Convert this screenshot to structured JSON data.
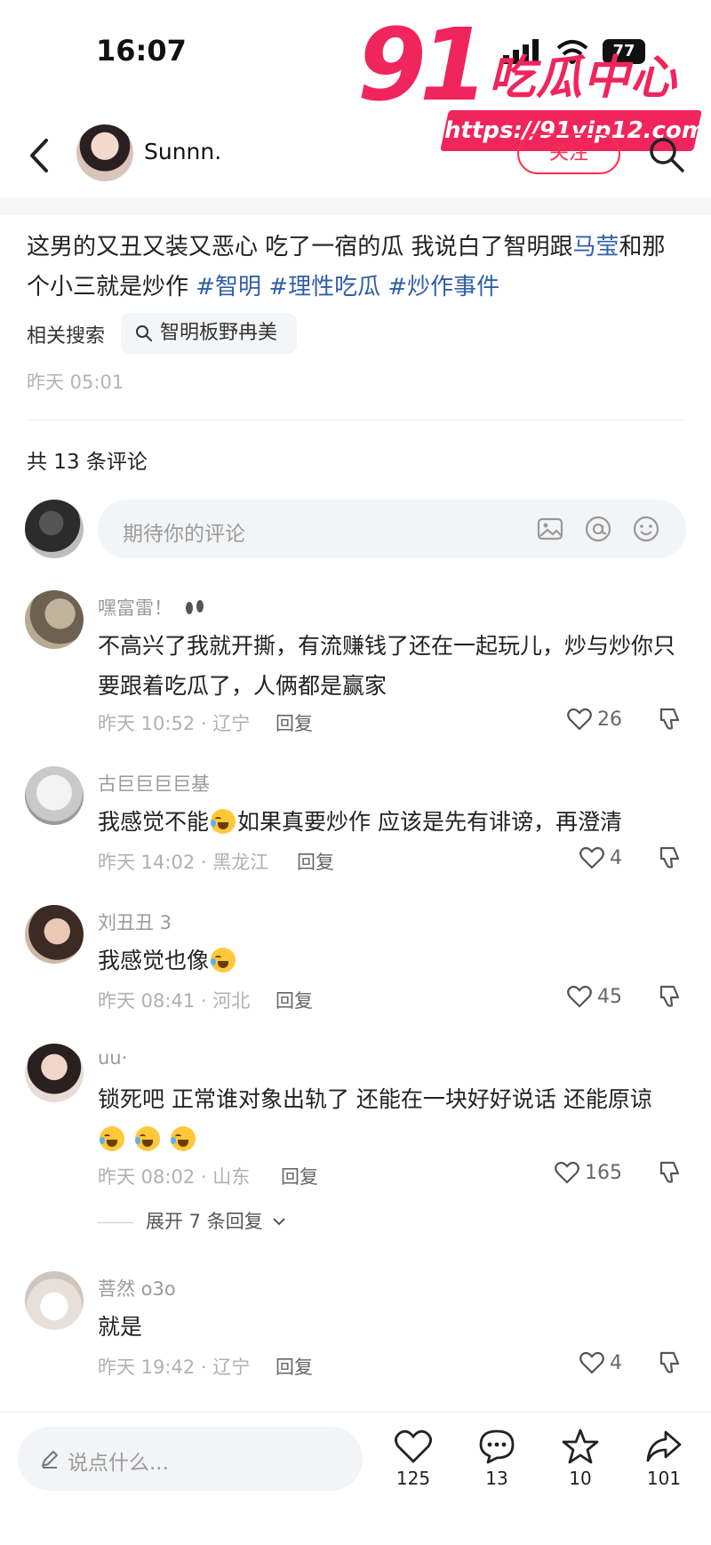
{
  "status_bar": {
    "time": "16:07",
    "battery": "77"
  },
  "watermark": {
    "brand": "91",
    "title": "吃瓜中心",
    "url": "https://91vip12.com"
  },
  "header": {
    "author": "Sunnn.",
    "follow_label": "关注"
  },
  "post": {
    "text_1": "这男的又丑又装又恶心 吃了一宿的瓜 我说白了智明跟",
    "mention": "马莹",
    "text_2": "和那个小三就是炒作 ",
    "tags": [
      "#智明",
      "#理性吃瓜",
      "#炒作事件"
    ],
    "related_label": "相关搜索",
    "related_query": "智明板野冉美",
    "time": "昨天 05:01"
  },
  "comments_section": {
    "title": "共 13 条评论",
    "input_placeholder": "期待你的评论",
    "reply_label": "回复"
  },
  "comments": [
    {
      "name": "嘿富雷！",
      "text": "不高兴了我就开撕，有流赚钱了还在一起玩儿，炒与炒你只要跟着吃瓜了，人俩都是赢家",
      "meta": "昨天 10:52 · 辽宁",
      "likes": "26"
    },
    {
      "name": "古巨巨巨巨基",
      "text_1": "我感觉不能",
      "text_2": "如果真要炒作 应该是先有诽谤，再澄清",
      "meta": "昨天 14:02 · 黑龙江",
      "likes": "4"
    },
    {
      "name": "刘丑丑 3",
      "text": "我感觉也像",
      "meta": "昨天 08:41 · 河北",
      "likes": "45"
    },
    {
      "name": "uu·",
      "text": "锁死吧 正常谁对象出轨了 还能在一块好好说话 还能原谅",
      "meta": "昨天 08:02 · 山东",
      "likes": "165",
      "expand": "展开 7 条回复"
    },
    {
      "name": "菩然 o3o",
      "text": "就是",
      "meta": "昨天 19:42 · 辽宁",
      "likes": "4"
    }
  ],
  "bottom_bar": {
    "say_placeholder": "说点什么...",
    "likes": "125",
    "comments": "13",
    "favorites": "10",
    "shares": "101"
  },
  "colors": {
    "accent": "#ff2e4d",
    "link": "#2f5fa8",
    "watermark": "#f0255c"
  }
}
